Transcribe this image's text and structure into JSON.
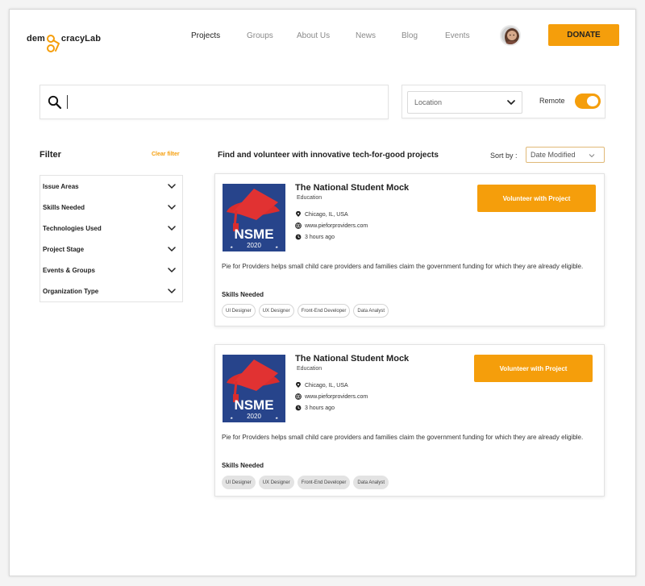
{
  "header": {
    "brand": {
      "part1": "dem",
      "part2": "cracyLab"
    },
    "nav": [
      "Projects",
      "Groups",
      "About Us",
      "News",
      "Blog",
      "Events"
    ],
    "active_nav": "Projects",
    "donate_label": "DONATE"
  },
  "search": {
    "value": "",
    "location_placeholder": "Location",
    "remote_label": "Remote",
    "remote_enabled": true
  },
  "filter": {
    "title": "Filter",
    "clear_label": "Clear filter",
    "items": [
      "Issue Areas",
      "Skills Needed",
      "Technologies Used",
      "Project Stage",
      "Events & Groups",
      "Organization Type"
    ]
  },
  "results": {
    "heading": "Find and volunteer with innovative tech-for-good projects",
    "sort_label": "Sort by :",
    "sort_value": "Date Modified"
  },
  "projects": [
    {
      "title": "The National Student Mock",
      "category": "Education",
      "location": "Chicago, IL, USA",
      "website": "www.pieforproviders.com",
      "updated": "3 hours ago",
      "volunteer_label": "Volunteer with Project",
      "description": "Pie for Providers helps small child care providers and families claim the government funding for which they are already eligible.",
      "skills_title": "Skills Needed",
      "skills": [
        "UI Designer",
        "UX Designer",
        "Front-End Developer",
        "Data Analyst"
      ],
      "image": {
        "label": "NSME",
        "year": "2020"
      }
    },
    {
      "title": "The National Student Mock",
      "category": "Education",
      "location": "Chicago, IL, USA",
      "website": "www.pieforproviders.com",
      "updated": "3 hours ago",
      "volunteer_label": "Volunteer with Project",
      "description": "Pie for Providers helps small child care providers and families claim the government funding for which they are already eligible.",
      "skills_title": "Skills Needed",
      "skills": [
        "UI Designer",
        "UX Designer",
        "Front-End Developer",
        "Data Analyst"
      ],
      "image": {
        "label": "NSME",
        "year": "2020"
      }
    }
  ],
  "colors": {
    "accent": "#f59e0b",
    "project_blue": "#27448b",
    "project_red": "#d92d2d"
  }
}
